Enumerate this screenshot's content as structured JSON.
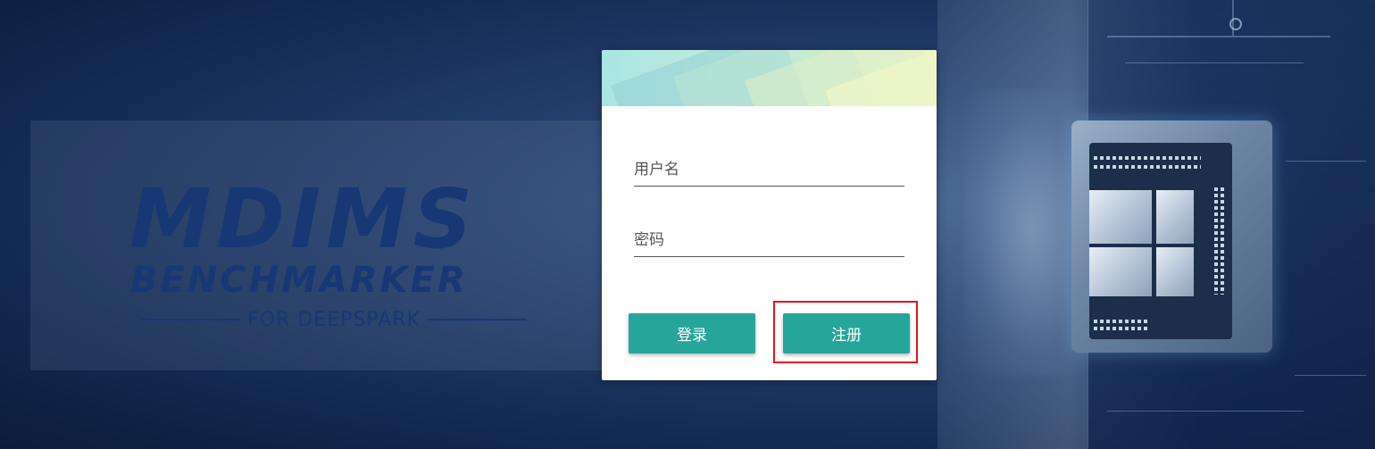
{
  "logo": {
    "title": "MDIMS",
    "subtitle": "BENCHMARKER",
    "tagline": "FOR DEEPSPARK"
  },
  "login_form": {
    "username": {
      "placeholder": "用户名",
      "value": ""
    },
    "password": {
      "placeholder": "密码",
      "value": ""
    },
    "login_label": "登录",
    "register_label": "注册"
  },
  "colors": {
    "button": "#26a69a",
    "highlight": "#e0161b",
    "logo": "#173874"
  }
}
